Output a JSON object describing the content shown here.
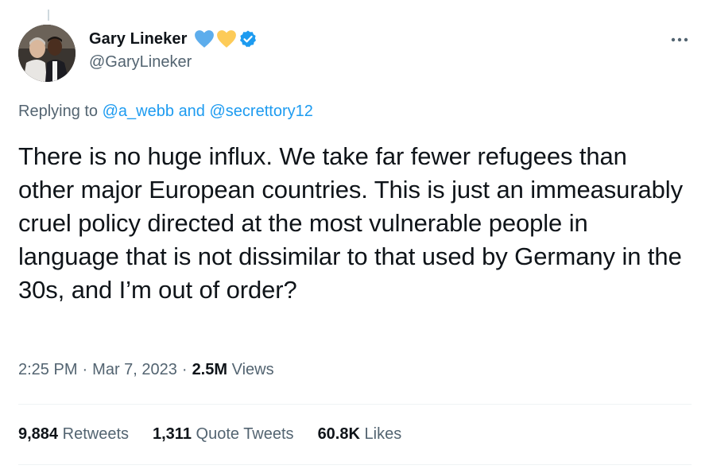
{
  "author": {
    "display_name": "Gary Lineker",
    "handle": "@GaryLineker",
    "badges": [
      "blue-heart-icon",
      "yellow-heart-icon",
      "verified-badge-icon"
    ]
  },
  "replying": {
    "prefix": "Replying to",
    "user1": "@a_webb",
    "joiner": "and",
    "user2": "@secrettory12"
  },
  "tweet": {
    "text": "There is no huge influx. We take far fewer refugees than other major European countries. This is just an immeasurably cruel policy directed at the most vulnerable people in language that is not dissimilar to that used by Germany in the 30s, and I’m out of order?"
  },
  "meta": {
    "time": "2:25 PM",
    "sep1": "·",
    "date": "Mar 7, 2023",
    "sep2": "·",
    "views_count": "2.5M",
    "views_label": "Views"
  },
  "stats": {
    "retweets_count": "9,884",
    "retweets_label": "Retweets",
    "quotes_count": "1,311",
    "quotes_label": "Quote Tweets",
    "likes_count": "60.8K",
    "likes_label": "Likes"
  },
  "colors": {
    "link": "#1d9bf0",
    "muted": "#536471",
    "text": "#0f1419",
    "divider": "#eff3f4"
  }
}
